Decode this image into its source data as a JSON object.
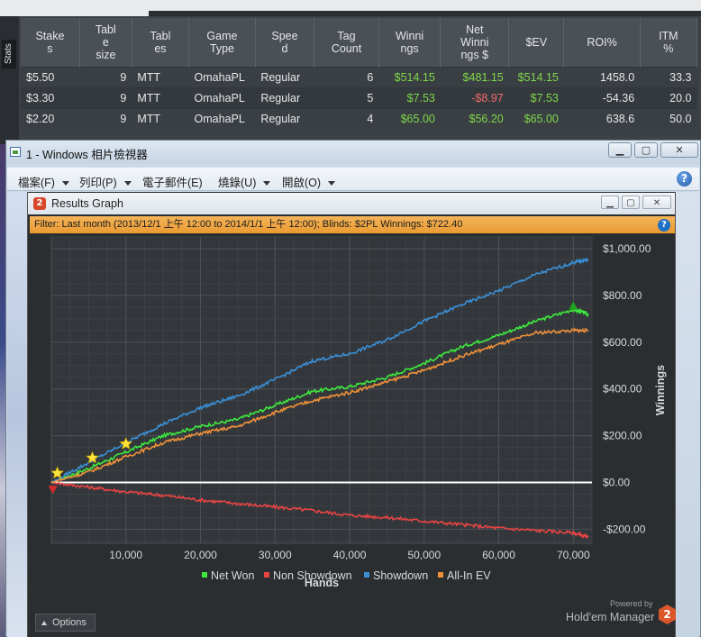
{
  "stats": {
    "side_label": "Stats",
    "headers": [
      "Stake\ns",
      "Tabl\ne\nsize",
      "Tabl\nes",
      "Game\nType",
      "Spee\nd",
      "Tag\nCount",
      "Winni\nngs",
      "Net\nWinni\nngs $",
      "$EV",
      "ROI%",
      "ITM\n%"
    ],
    "rows": [
      {
        "stake": "$5.50",
        "table_size": "9",
        "tables": "MTT",
        "game": "OmahaPL",
        "speed": "Regular",
        "tag_count": "6",
        "winnings": "$514.15",
        "net": "$481.15",
        "ev": "$514.15",
        "roi": "1458.0",
        "itm": "33.3",
        "net_negative": false
      },
      {
        "stake": "$3.30",
        "table_size": "9",
        "tables": "MTT",
        "game": "OmahaPL",
        "speed": "Regular",
        "tag_count": "5",
        "winnings": "$7.53",
        "net": "-$8.97",
        "ev": "$7.53",
        "roi": "-54.36",
        "itm": "20.0",
        "net_negative": true
      },
      {
        "stake": "$2.20",
        "table_size": "9",
        "tables": "MTT",
        "game": "OmahaPL",
        "speed": "Regular",
        "tag_count": "4",
        "winnings": "$65.00",
        "net": "$56.20",
        "ev": "$65.00",
        "roi": "638.6",
        "itm": "50.0",
        "net_negative": false
      }
    ]
  },
  "viewer": {
    "title": "1 - Windows 相片檢視器",
    "menu": [
      {
        "label": "檔案(F)"
      },
      {
        "label": "列印(P)"
      },
      {
        "label": "電子郵件(E)"
      },
      {
        "label": "燒錄(U)"
      },
      {
        "label": "開啟(O)"
      }
    ],
    "help_glyph": "?"
  },
  "results_graph": {
    "title": "Results Graph",
    "logo_glyph": "2",
    "filter_text": "Filter: Last month (2013/12/1 上午 12:00 to 2014/1/1 上午 12:00); Blinds: $2PL Winnings: $722.40",
    "options_label": "Options",
    "powered_by": "Powered by",
    "brand": "Hold'em Manager",
    "brand_glyph": "2"
  },
  "chart_data": {
    "type": "line",
    "xlabel": "Hands",
    "ylabel": "Winnings",
    "xlim": [
      0,
      72500
    ],
    "ylim": [
      -260,
      1050
    ],
    "x_ticks": [
      10000,
      20000,
      30000,
      40000,
      50000,
      60000,
      70000
    ],
    "x_tick_labels": [
      "10,000",
      "20,000",
      "30,000",
      "40,000",
      "50,000",
      "60,000",
      "70,000"
    ],
    "y_ticks": [
      1000,
      800,
      600,
      400,
      200,
      0,
      -200
    ],
    "y_tick_labels": [
      "$1,000.00",
      "$800.00",
      "$600.00",
      "$400.00",
      "$200.00",
      "$0.00",
      "-$200.00"
    ],
    "grid": true,
    "legend": "bottom",
    "series": [
      {
        "name": "Net Won",
        "color": "#3ee83e",
        "x": [
          0,
          5000,
          10000,
          15000,
          20000,
          25000,
          30000,
          35000,
          40000,
          45000,
          50000,
          55000,
          60000,
          65000,
          70000,
          72000
        ],
        "y": [
          0,
          60,
          130,
          200,
          240,
          270,
          330,
          390,
          410,
          450,
          510,
          580,
          630,
          690,
          740,
          720
        ]
      },
      {
        "name": "Non Showdown",
        "color": "#e84444",
        "x": [
          0,
          5000,
          10000,
          15000,
          20000,
          25000,
          30000,
          35000,
          40000,
          45000,
          50000,
          55000,
          60000,
          65000,
          70000,
          72000
        ],
        "y": [
          0,
          -20,
          -40,
          -55,
          -75,
          -90,
          -105,
          -120,
          -140,
          -150,
          -165,
          -180,
          -195,
          -205,
          -215,
          -235
        ]
      },
      {
        "name": "Showdown",
        "color": "#3a8fd6",
        "x": [
          0,
          5000,
          10000,
          15000,
          20000,
          25000,
          30000,
          35000,
          40000,
          45000,
          50000,
          55000,
          60000,
          65000,
          70000,
          72000
        ],
        "y": [
          0,
          85,
          170,
          250,
          320,
          370,
          440,
          520,
          550,
          610,
          690,
          760,
          820,
          890,
          940,
          955
        ]
      },
      {
        "name": "All-In EV",
        "color": "#f0913a",
        "x": [
          0,
          5000,
          10000,
          15000,
          20000,
          25000,
          30000,
          35000,
          40000,
          45000,
          50000,
          55000,
          60000,
          65000,
          70000,
          72000
        ],
        "y": [
          0,
          45,
          110,
          170,
          210,
          240,
          300,
          350,
          385,
          430,
          480,
          540,
          590,
          640,
          650,
          650
        ]
      }
    ],
    "star_markers": {
      "x": [
        800,
        5500,
        10000
      ],
      "y": [
        40,
        105,
        165
      ]
    },
    "max_marker": {
      "x": 70000,
      "y": 755
    },
    "min_marker": {
      "x": 200,
      "y": -30
    }
  }
}
